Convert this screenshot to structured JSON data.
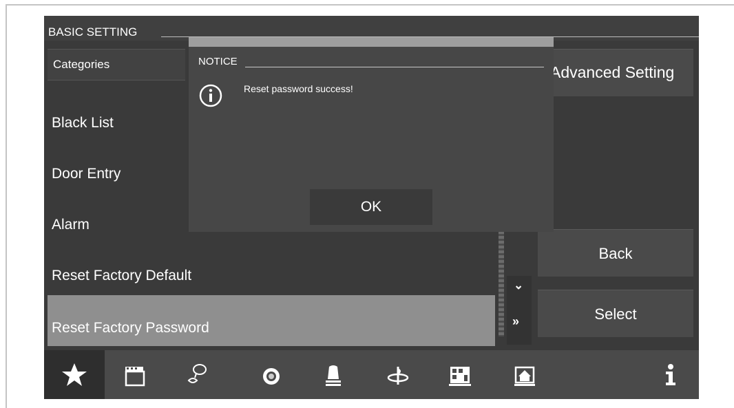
{
  "header": {
    "title": "BASIC SETTING"
  },
  "categories": {
    "header": "Categories",
    "items": [
      {
        "label": "Black List"
      },
      {
        "label": "Door Entry"
      },
      {
        "label": "Alarm"
      },
      {
        "label": "Reset Factory Default"
      },
      {
        "label": "Reset Factory Password",
        "selected": true
      }
    ]
  },
  "buttons": {
    "advanced": "Advanced Setting",
    "back": "Back",
    "select": "Select"
  },
  "scroll": {
    "down_icon": "chevron-down-icon",
    "page_down_icon": "double-chevron-down-icon"
  },
  "dialog": {
    "title": "NOTICE",
    "message": "Reset password success!",
    "icon": "info-icon",
    "ok_label": "OK"
  },
  "dock": {
    "items": [
      {
        "icon": "star-icon",
        "active": true
      },
      {
        "icon": "clapperboard-icon"
      },
      {
        "icon": "chat-icon"
      },
      {
        "icon": "camera-icon"
      },
      {
        "icon": "siren-icon"
      },
      {
        "icon": "flower-icon"
      },
      {
        "icon": "building-icon"
      },
      {
        "icon": "home-icon"
      },
      {
        "icon": "info-icon"
      }
    ]
  },
  "colors": {
    "background": "#3a3a3a",
    "selected": "#8f8f8f",
    "accent": "#ffffff"
  }
}
